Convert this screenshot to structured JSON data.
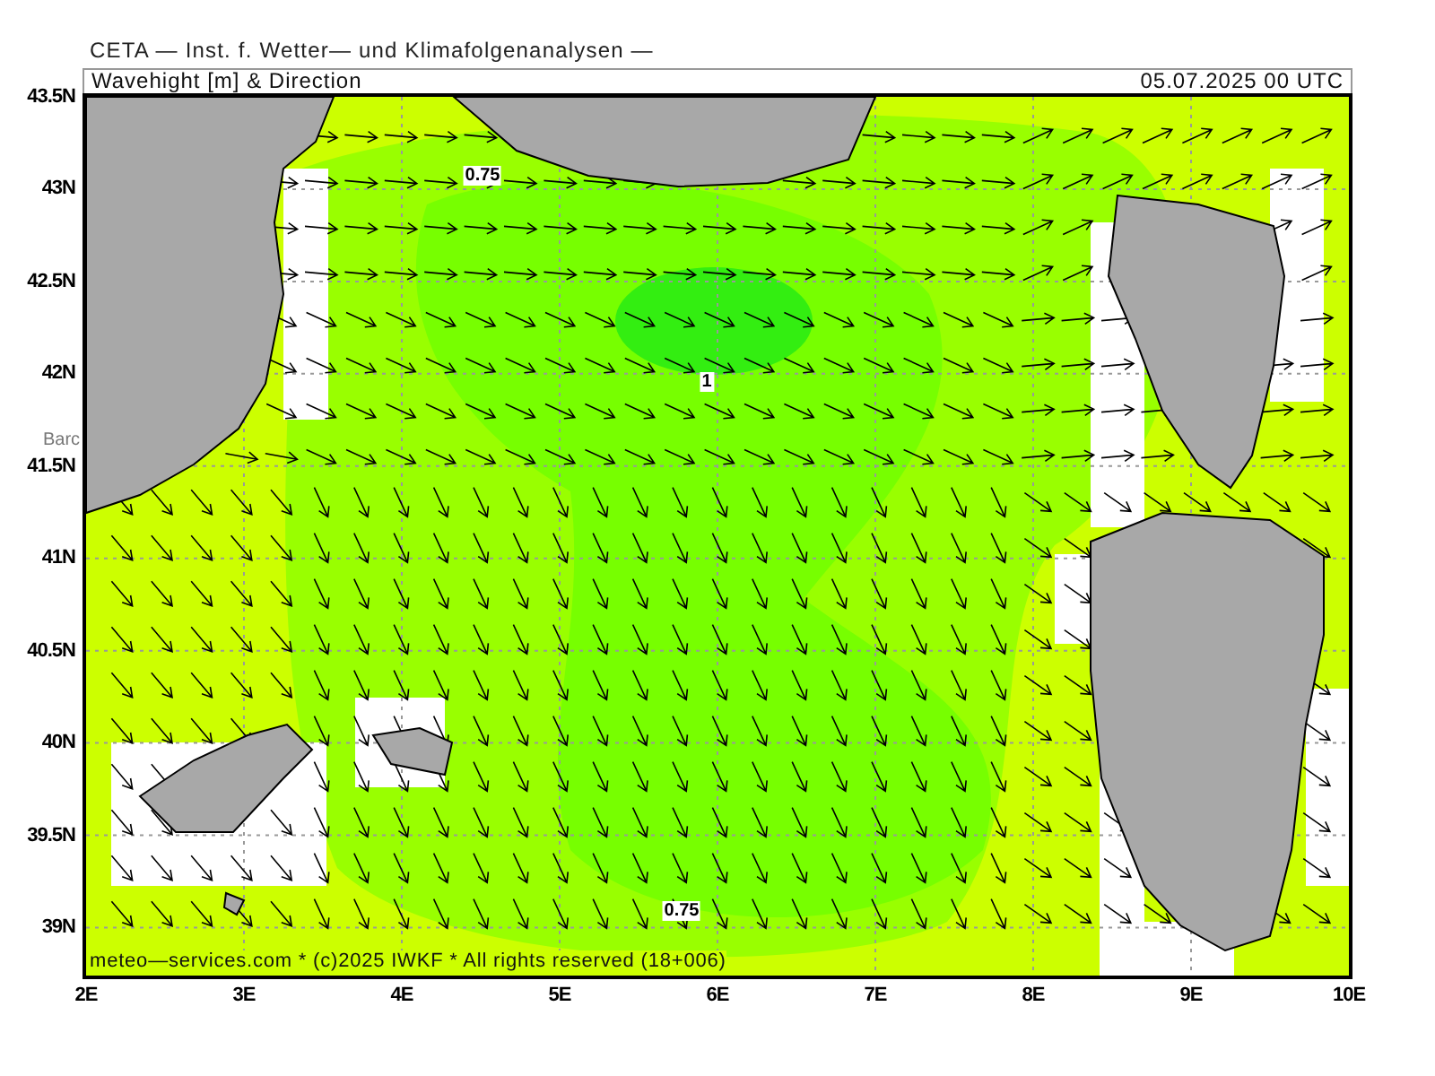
{
  "header": "CETA — Inst. f. Wetter— und Klimafolgenanalysen —",
  "title_bar": {
    "title": "Wavehight [m] & Direction",
    "datetime": "05.07.2025 00 UTC"
  },
  "map": {
    "contour_labels": [
      "0.75",
      "1",
      "0.75"
    ],
    "place_labels": [
      "Barc"
    ],
    "footer": "meteo—services.com * (c)2025 IWKF * All rights reserved (18+006)"
  },
  "y_axis": [
    "43.5N",
    "43N",
    "42.5N",
    "42N",
    "41.5N",
    "41N",
    "40.5N",
    "40N",
    "39.5N",
    "39N"
  ],
  "x_axis": [
    "2E",
    "3E",
    "4E",
    "5E",
    "6E",
    "7E",
    "8E",
    "9E",
    "10E"
  ]
}
